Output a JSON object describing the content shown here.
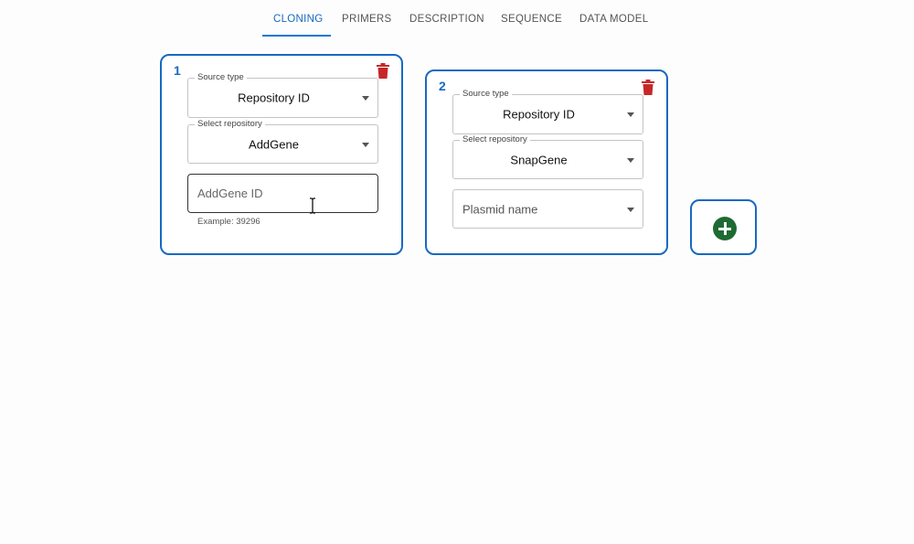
{
  "tabs": [
    {
      "label": "CLONING",
      "active": true
    },
    {
      "label": "PRIMERS",
      "active": false
    },
    {
      "label": "DESCRIPTION",
      "active": false
    },
    {
      "label": "SEQUENCE",
      "active": false
    },
    {
      "label": "DATA MODEL",
      "active": false
    }
  ],
  "sources": [
    {
      "number": "1",
      "source_type": {
        "label": "Source type",
        "value": "Repository ID"
      },
      "repository": {
        "label": "Select repository",
        "value": "AddGene"
      },
      "id_field": {
        "placeholder": "AddGene ID",
        "value": "",
        "helper": "Example: 39296"
      },
      "delete_icon": "trash-icon"
    },
    {
      "number": "2",
      "source_type": {
        "label": "Source type",
        "value": "Repository ID"
      },
      "repository": {
        "label": "Select repository",
        "value": "SnapGene"
      },
      "plasmid_select": {
        "placeholder": "Plasmid name"
      },
      "delete_icon": "trash-icon"
    }
  ],
  "add_button": {
    "icon": "plus-circle-icon"
  },
  "colors": {
    "accent": "#1976d2",
    "delete": "#c62828",
    "add": "#1e6b32"
  }
}
